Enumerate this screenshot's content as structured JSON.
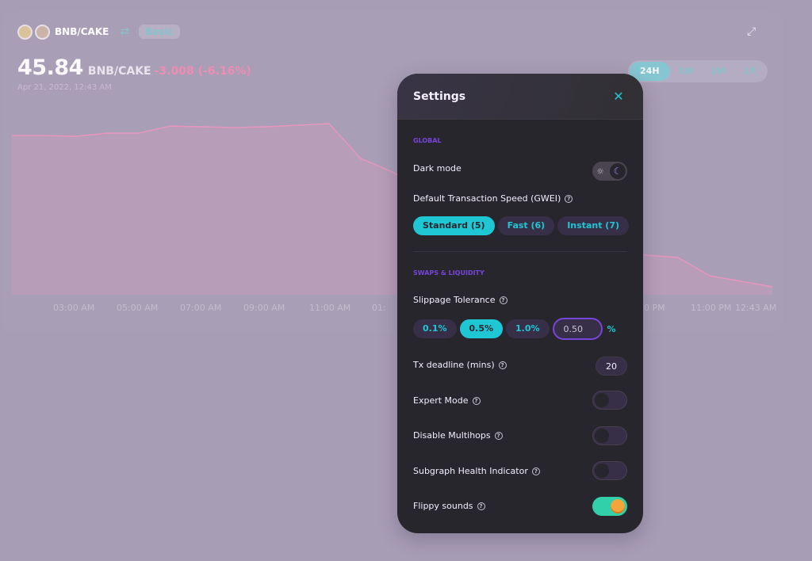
{
  "header": {
    "pair": "BNB/CAKE",
    "mode_label": "Basic",
    "price": "45.84",
    "price_pair": "BNB/CAKE",
    "change": "-3.008 (-6.16%)",
    "date": "Apr 21, 2022, 12:43 AM",
    "ranges": [
      "24H",
      "1W",
      "1M",
      "1Y"
    ],
    "active_range": "24H"
  },
  "chart": {
    "time_labels": [
      "03:00 AM",
      "05:00 AM",
      "07:00 AM",
      "09:00 AM",
      "11:00 AM",
      "01:",
      "0 PM",
      "11:00 PM",
      "12:43 AM"
    ],
    "colors": {
      "line": "#e696bd",
      "fill": "#b89cb7"
    }
  },
  "settings": {
    "title": "Settings",
    "global_label": "GLOBAL",
    "dark_mode_label": "Dark mode",
    "speed_label": "Default Transaction Speed (GWEI)",
    "speed_options": [
      "Standard (5)",
      "Fast (6)",
      "Instant (7)"
    ],
    "speed_selected": "Standard (5)",
    "swaps_label": "SWAPS & LIQUIDITY",
    "slippage_label": "Slippage Tolerance",
    "slippage_options": [
      "0.1%",
      "0.5%",
      "1.0%"
    ],
    "slippage_selected": "0.5%",
    "slippage_value": "0.50",
    "slippage_unit": "%",
    "deadline_label": "Tx deadline (mins)",
    "deadline_value": "20",
    "expert_label": "Expert Mode",
    "multihops_label": "Disable Multihops",
    "subgraph_label": "Subgraph Health Indicator",
    "flippy_label": "Flippy sounds",
    "toggles": {
      "dark_mode": true,
      "expert": false,
      "multihops": false,
      "subgraph": false,
      "flippy": true
    },
    "colors": {
      "accent": "#1fc7d4",
      "purple": "#7645d9",
      "success": "#31d0aa"
    }
  }
}
